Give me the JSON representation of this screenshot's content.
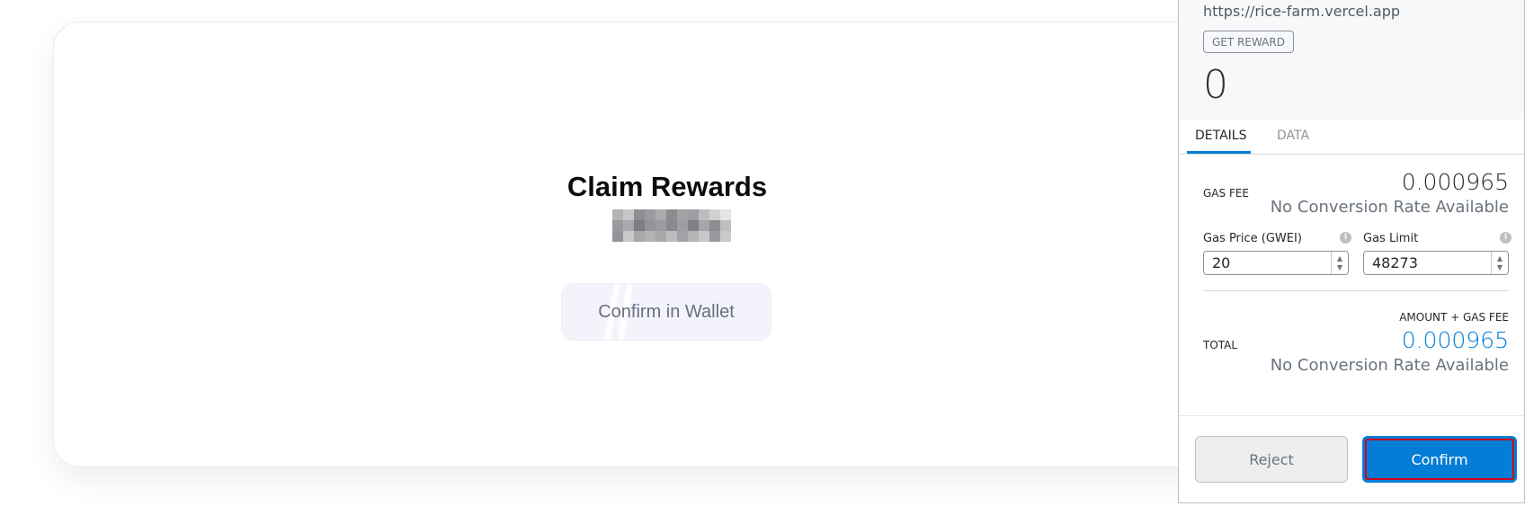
{
  "dapp": {
    "title": "Claim Rewards",
    "confirm_button": "Confirm in Wallet"
  },
  "wallet": {
    "origin": "https://rice-farm.vercel.app",
    "action": "GET REWARD",
    "amount": "0",
    "tabs": [
      "DETAILS",
      "DATA"
    ],
    "active_tab": "DETAILS",
    "gas_fee_label": "GAS FEE",
    "gas_fee_value": "0.000965",
    "no_conversion": "No Conversion Rate Available",
    "gas_price_label": "Gas Price (GWEI)",
    "gas_price_value": "20",
    "gas_limit_label": "Gas Limit",
    "gas_limit_value": "48273",
    "amount_gas_fee_label": "AMOUNT + GAS FEE",
    "total_label": "TOTAL",
    "total_value": "0.000965",
    "total_no_conversion": "No Conversion Rate Available",
    "reject_label": "Reject",
    "confirm_label": "Confirm",
    "accent_color": "#037dd6"
  }
}
